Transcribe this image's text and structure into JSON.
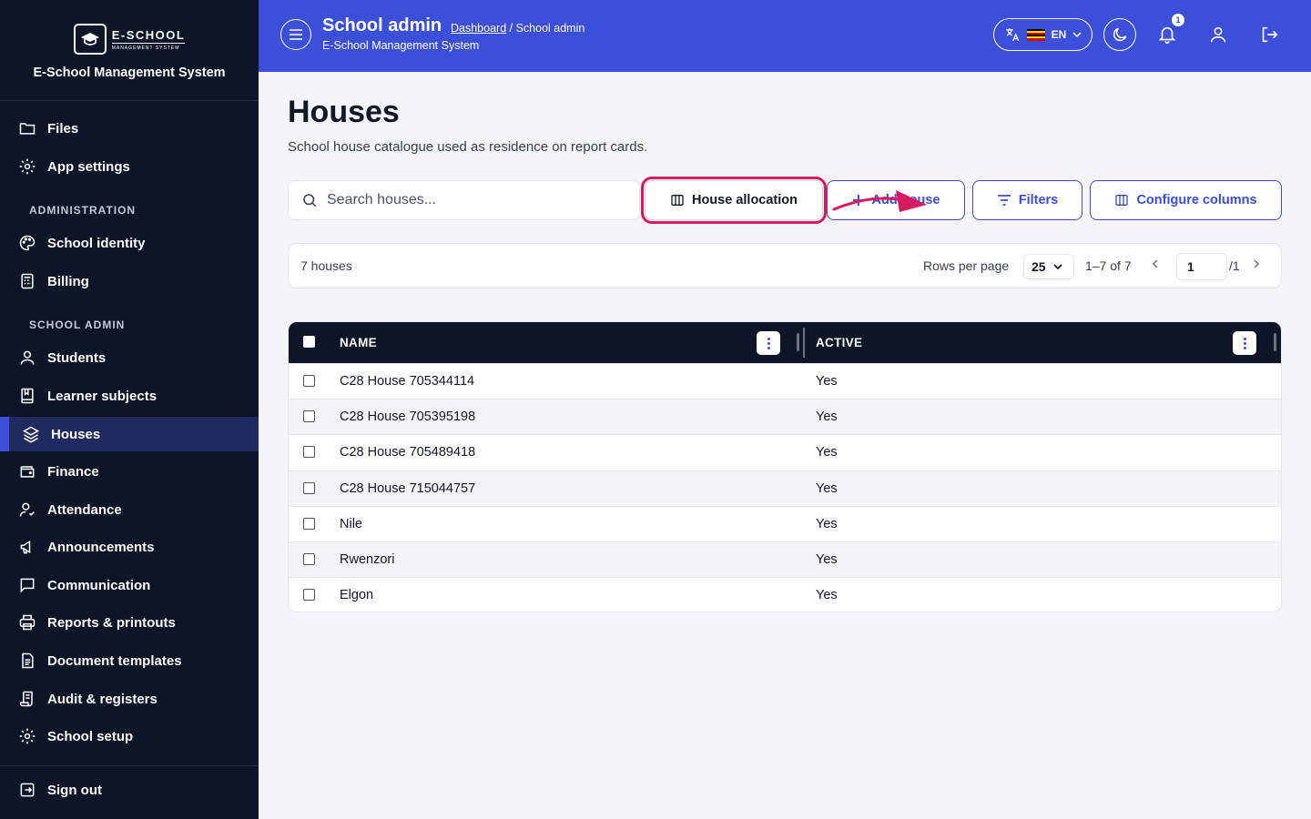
{
  "sidebar": {
    "logo_main": "E-SCHOOL",
    "logo_sub": "MANAGEMENT SYSTEM",
    "brand_name": "E-School Management System",
    "items": [
      {
        "label": "Files"
      },
      {
        "label": "App settings"
      },
      {
        "label": "School identity"
      },
      {
        "label": "Billing"
      },
      {
        "label": "Students"
      },
      {
        "label": "Learner subjects"
      },
      {
        "label": "Houses"
      },
      {
        "label": "Finance"
      },
      {
        "label": "Attendance"
      },
      {
        "label": "Announcements"
      },
      {
        "label": "Communication"
      },
      {
        "label": "Reports & printouts"
      },
      {
        "label": "Document templates"
      },
      {
        "label": "Audit & registers"
      },
      {
        "label": "School setup"
      },
      {
        "label": "Sign out"
      }
    ],
    "sections": {
      "administration": "ADMINISTRATION",
      "school_admin": "SCHOOL ADMIN"
    },
    "active_item": "Houses"
  },
  "header": {
    "title": "School admin",
    "breadcrumb_link": "Dashboard",
    "breadcrumb_rest": " / School admin",
    "subtitle": "E-School Management System",
    "language": "EN",
    "notification_count": "1",
    "accent_color": "#3b4fd8"
  },
  "page": {
    "title": "Houses",
    "description": "School house catalogue used as residence on report cards."
  },
  "toolbar": {
    "search_placeholder": "Search houses...",
    "house_allocation": "House allocation",
    "add_house": "Add house",
    "filters": "Filters",
    "configure_columns": "Configure columns"
  },
  "pagination": {
    "count": "7 houses",
    "rows_per_page_label": "Rows per page",
    "rows_per_page": "25",
    "range": "1–7 of 7",
    "page": "1",
    "total_pages": "/1"
  },
  "table": {
    "columns": {
      "name": "NAME",
      "active": "ACTIVE"
    },
    "rows": [
      {
        "name": "C28 House 705344114",
        "active": "Yes"
      },
      {
        "name": "C28 House 705395198",
        "active": "Yes"
      },
      {
        "name": "C28 House 705489418",
        "active": "Yes"
      },
      {
        "name": "C28 House 715044757",
        "active": "Yes"
      },
      {
        "name": "Nile",
        "active": "Yes"
      },
      {
        "name": "Rwenzori",
        "active": "Yes"
      },
      {
        "name": "Elgon",
        "active": "Yes"
      }
    ]
  }
}
